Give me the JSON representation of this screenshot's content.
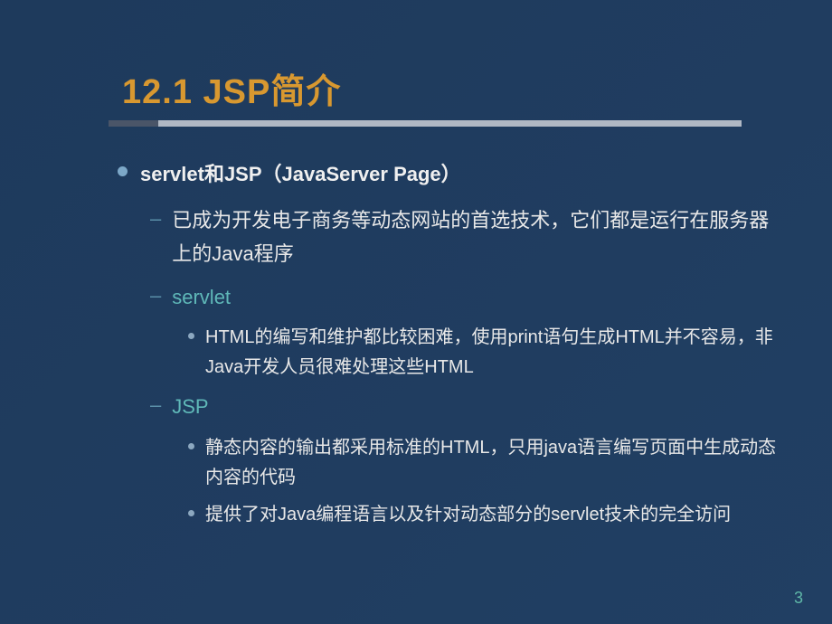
{
  "title": "12.1 JSP简介",
  "main_heading": "servlet和JSP（JavaServer Page）",
  "intro_text": "已成为开发电子商务等动态网站的首选技术，它们都是运行在服务器上的Java程序",
  "section1": {
    "heading": "servlet",
    "item1": "HTML的编写和维护都比较困难，使用print语句生成HTML并不容易，非Java开发人员很难处理这些HTML"
  },
  "section2": {
    "heading": "JSP",
    "item1": "静态内容的输出都采用标准的HTML，只用java语言编写页面中生成动态内容的代码",
    "item2": "提供了对Java编程语言以及针对动态部分的servlet技术的完全访问"
  },
  "page_number": "3"
}
